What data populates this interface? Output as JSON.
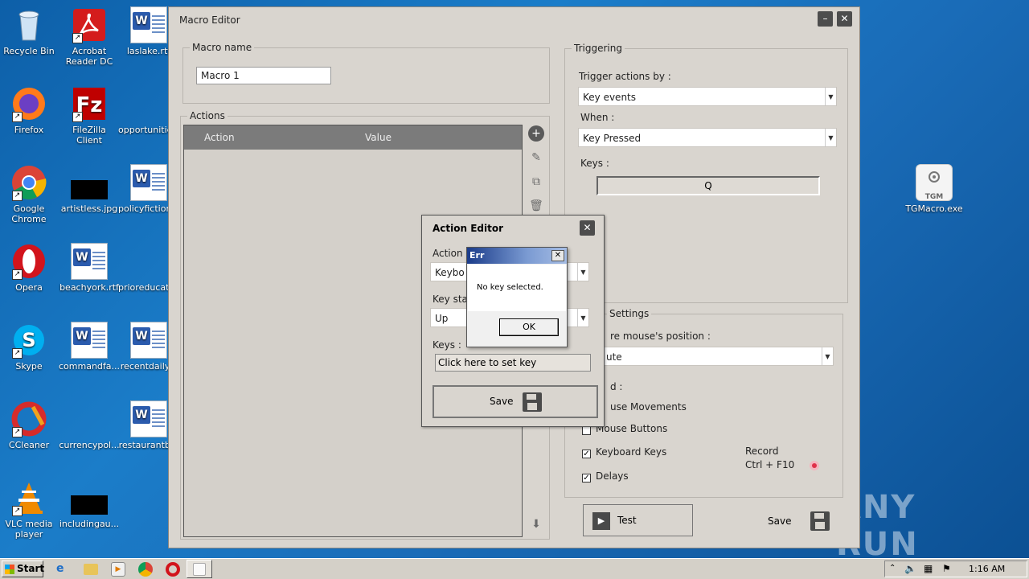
{
  "desktop": {
    "icons": [
      {
        "label": "Recycle Bin"
      },
      {
        "label": "Acrobat Reader DC"
      },
      {
        "label": "laslake.rtf"
      },
      {
        "label": "Firefox"
      },
      {
        "label": "FileZilla Client"
      },
      {
        "label": "opportunitie..."
      },
      {
        "label": "Google Chrome"
      },
      {
        "label": "artistless.jpg"
      },
      {
        "label": "policyfiction..."
      },
      {
        "label": "Opera"
      },
      {
        "label": "beachyork.rtf"
      },
      {
        "label": "prioreducati..."
      },
      {
        "label": "Skype"
      },
      {
        "label": "commandfa..."
      },
      {
        "label": "recentdaily..."
      },
      {
        "label": "CCleaner"
      },
      {
        "label": "currencypol..."
      },
      {
        "label": "restaurantb..."
      },
      {
        "label": "VLC media player"
      },
      {
        "label": "includingau..."
      },
      {
        "label": "TGMacro.exe"
      }
    ],
    "icon_inner": {
      "tgm": "TGM"
    },
    "watermark": "ANY RUN"
  },
  "macro_editor": {
    "title": "Macro Editor",
    "macro_name_group": "Macro name",
    "macro_name_value": "Macro 1",
    "actions_group": "Actions",
    "table_headers": [
      "Action",
      "Value"
    ],
    "triggering": {
      "group": "Triggering",
      "trigger_label": "Trigger actions by :",
      "trigger_value": "Key events",
      "when_label": "When :",
      "when_value": "Key Pressed",
      "keys_label": "Keys :",
      "keys_value": "Q"
    },
    "settings": {
      "group": "Settings",
      "mouse_pos_label": "re mouse's position :",
      "mouse_pos_value": "ute",
      "record_label": "d :",
      "opt_mouse_movements": "use Movements",
      "opt_mouse_buttons": "Mouse Buttons",
      "opt_keyboard_keys": "Keyboard Keys",
      "opt_delays": "Delays",
      "record_hint_1": "Record",
      "record_hint_2": "Ctrl + F10"
    },
    "test_label": "Test",
    "save_label": "Save"
  },
  "action_editor": {
    "title": "Action Editor",
    "action_label": "Action",
    "action_value": "Keybo",
    "key_state_label": "Key sta",
    "key_state_value": "Up",
    "keys_label": "Keys :",
    "keys_value": "Click here to set key",
    "save_label": "Save"
  },
  "err_dialog": {
    "title": "Err",
    "message": "No key selected.",
    "ok_label": "OK"
  },
  "taskbar": {
    "start_label": "Start",
    "clock": "1:16 AM"
  },
  "colors": {
    "window_bg": "#d9d5cf",
    "table_header": "#7b7b7b",
    "record_dot": "#e0304a"
  }
}
